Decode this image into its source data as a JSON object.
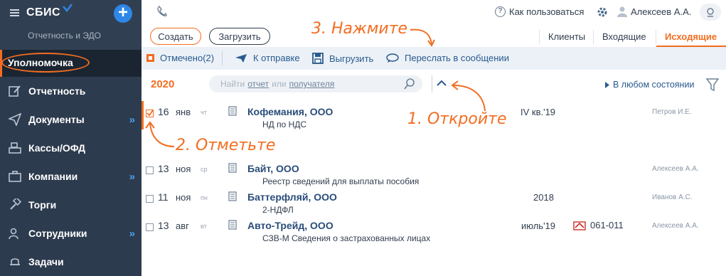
{
  "sidebar": {
    "logo": "СБИС",
    "subtitle": "Отчетность и ЭДО",
    "active_item": "Уполномочка",
    "items": [
      {
        "label": "Отчетность",
        "icon": "edit-icon",
        "chevron": false
      },
      {
        "label": "Документы",
        "icon": "send-icon",
        "chevron": true
      },
      {
        "label": "Кассы/ОФД",
        "icon": "cash-register-icon",
        "chevron": false
      },
      {
        "label": "Компании",
        "icon": "briefcase-icon",
        "chevron": true
      },
      {
        "label": "Торги",
        "icon": "gavel-icon",
        "chevron": false
      },
      {
        "label": "Сотрудники",
        "icon": "users-icon",
        "chevron": true
      },
      {
        "label": "Задачи",
        "icon": "bell-icon",
        "chevron": false
      }
    ],
    "chevron": "»"
  },
  "header": {
    "help": "Как пользоваться",
    "help_icon": "?",
    "user": "Алексеев А.А."
  },
  "toolbar": {
    "create": "Создать",
    "upload": "Загрузить",
    "tabs": [
      "Клиенты",
      "Входящие",
      "Исходящие"
    ]
  },
  "actions": {
    "marked": "Отмечено(2)",
    "send": "К отправке",
    "unload": "Выгрузить",
    "forward": "Переслать в сообщении"
  },
  "filter": {
    "year": "2020",
    "search_find": "Найти",
    "search_report": "отчет",
    "search_or": "или",
    "search_recipient": "получателя",
    "state": "В любом состоянии"
  },
  "rows": [
    {
      "day": "16",
      "month": "янв",
      "weekday": "чт",
      "company": "Кофемания, ООО",
      "desc": "НД по НДС",
      "period": "IV кв.'19",
      "code": "",
      "person": "Петров И.Е.",
      "checked": true
    },
    {
      "day": "13",
      "month": "ноя",
      "weekday": "ср",
      "company": "Байт, ООО",
      "desc": "Реестр сведений для выплаты пособия",
      "period": "",
      "code": "",
      "person": "Алексеев А.А.",
      "checked": false
    },
    {
      "day": "11",
      "month": "ноя",
      "weekday": "пн",
      "company": "Баттерфляй, ООО",
      "desc": "2-НДФЛ",
      "period": "2018",
      "code": "",
      "person": "Иванов А.С.",
      "checked": false
    },
    {
      "day": "13",
      "month": "авг",
      "weekday": "вт",
      "company": "Авто-Трейд, ООО",
      "desc": "СЗВ-М Сведения о застрахованных лицах",
      "period": "июль'19",
      "code": "061-011",
      "person": "Алексеев А.А.",
      "checked": false
    }
  ],
  "annotations": {
    "step1": "1. Откройте",
    "step2": "2. Отметьте",
    "step3": "3. Нажмите"
  },
  "colors": {
    "accent": "#f26d21",
    "sidebar": "#2d3b4e",
    "link": "#2a5a8e"
  }
}
